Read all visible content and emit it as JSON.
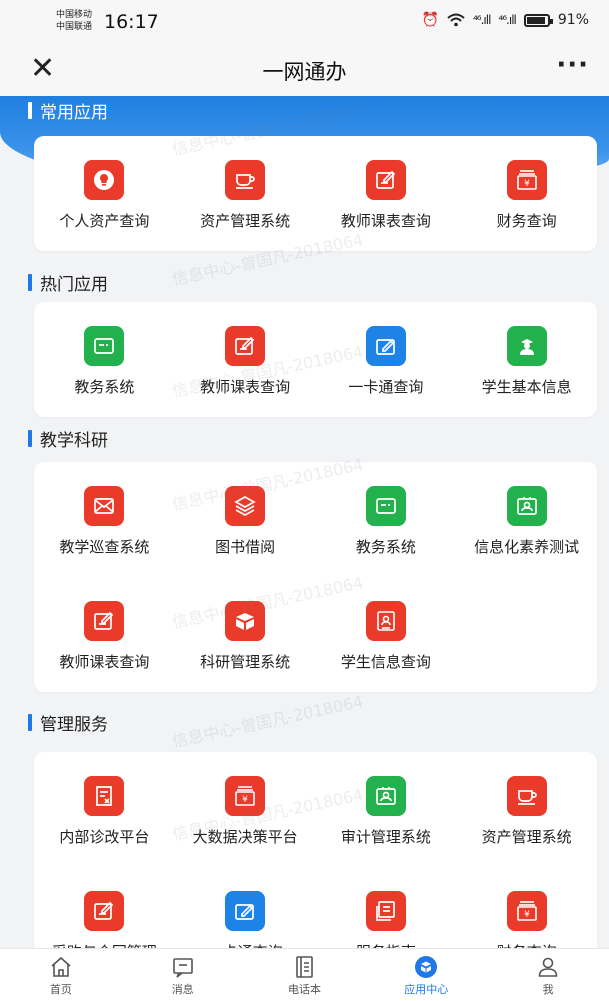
{
  "status": {
    "carrier1": "中国移动",
    "carrier2": "中国联通",
    "time": "16:17",
    "signal1": "⁴⁶.ıll",
    "signal2": "⁴⁶.ıll",
    "battery": "91%"
  },
  "header": {
    "close": "✕",
    "title": "一网通办",
    "more": "···"
  },
  "watermark": "信息中心-曾国凡-2018064",
  "sections": [
    {
      "title": "常用应用",
      "apps": [
        {
          "label": "个人资产查询",
          "icon": "lightbulb-icon",
          "color": "#ea3b2a"
        },
        {
          "label": "资产管理系统",
          "icon": "cup-icon",
          "color": "#ea3b2a"
        },
        {
          "label": "教师课表查询",
          "icon": "edit-form-icon",
          "color": "#ea3b2a"
        },
        {
          "label": "财务查询",
          "icon": "finance-register-icon",
          "color": "#ea3b2a"
        }
      ]
    },
    {
      "title": "热门应用",
      "apps": [
        {
          "label": "教务系统",
          "icon": "card-icon",
          "color": "#22b14c"
        },
        {
          "label": "教师课表查询",
          "icon": "edit-form-icon",
          "color": "#ea3b2a"
        },
        {
          "label": "一卡通查询",
          "icon": "pen-card-icon",
          "color": "#1e83e6"
        },
        {
          "label": "学生基本信息",
          "icon": "student-icon",
          "color": "#22b14c"
        }
      ]
    },
    {
      "title": "教学科研",
      "apps": [
        {
          "label": "教学巡查系统",
          "icon": "mail-icon",
          "color": "#ea3b2a"
        },
        {
          "label": "图书借阅",
          "icon": "layers-icon",
          "color": "#ea3b2a"
        },
        {
          "label": "教务系统",
          "icon": "card-icon",
          "color": "#22b14c"
        },
        {
          "label": "信息化素养测试",
          "icon": "person-frame-icon",
          "color": "#22b14c"
        },
        {
          "label": "教师课表查询",
          "icon": "edit-form-icon",
          "color": "#ea3b2a"
        },
        {
          "label": "科研管理系统",
          "icon": "box-icon",
          "color": "#ea3b2a"
        },
        {
          "label": "学生信息查询",
          "icon": "id-card-icon",
          "color": "#ea3b2a"
        }
      ]
    },
    {
      "title": "管理服务",
      "apps": [
        {
          "label": "内部诊改平台",
          "icon": "doc-x-icon",
          "color": "#ea3b2a"
        },
        {
          "label": "大数据决策平台",
          "icon": "finance-register-icon",
          "color": "#ea3b2a"
        },
        {
          "label": "审计管理系统",
          "icon": "person-frame-icon",
          "color": "#22b14c"
        },
        {
          "label": "资产管理系统",
          "icon": "cup-icon",
          "color": "#ea3b2a"
        },
        {
          "label": "采购与合同管理",
          "icon": "edit-form-icon",
          "color": "#ea3b2a"
        },
        {
          "label": "一卡通查询",
          "icon": "pen-card-icon",
          "color": "#1e83e6"
        },
        {
          "label": "服务指南",
          "icon": "guide-icon",
          "color": "#ea3b2a"
        },
        {
          "label": "财务查询",
          "icon": "finance-register-icon",
          "color": "#ea3b2a"
        }
      ]
    }
  ],
  "tabs": [
    {
      "label": "首页",
      "icon": "home-icon",
      "active": false
    },
    {
      "label": "消息",
      "icon": "message-icon",
      "active": false
    },
    {
      "label": "电话本",
      "icon": "phonebook-icon",
      "active": false
    },
    {
      "label": "应用中心",
      "icon": "app-center-icon",
      "active": true
    },
    {
      "label": "我",
      "icon": "person-icon",
      "active": false
    }
  ]
}
